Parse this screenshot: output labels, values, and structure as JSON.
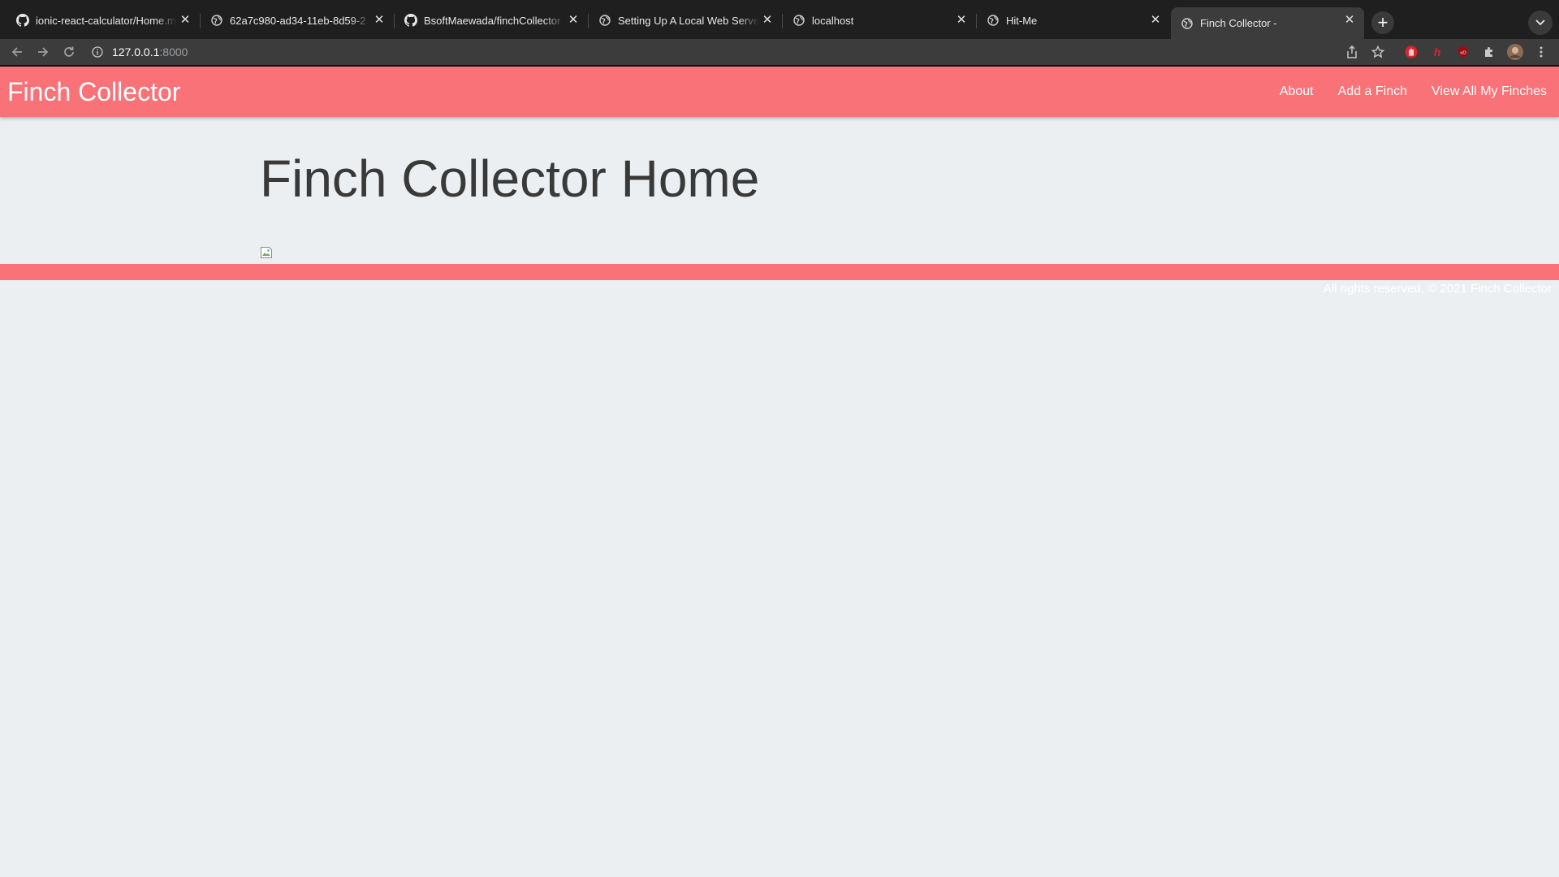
{
  "browser": {
    "tabs": [
      {
        "title": "ionic-react-calculator/Home.m",
        "icon": "github-icon",
        "active": false
      },
      {
        "title": "62a7c980-ad34-11eb-8d59-2",
        "icon": "globe-icon",
        "active": false
      },
      {
        "title": "BsoftMaewada/finchCollector",
        "icon": "github-icon",
        "active": false
      },
      {
        "title": "Setting Up A Local Web Server",
        "icon": "globe-icon",
        "active": false
      },
      {
        "title": "localhost",
        "icon": "globe-icon",
        "active": false
      },
      {
        "title": "Hit-Me",
        "icon": "globe-icon",
        "active": false
      },
      {
        "title": "Finch Collector -",
        "icon": "globe-icon",
        "active": true
      }
    ],
    "address": {
      "host": "127.0.0.1",
      "port": ":8000"
    }
  },
  "navbar": {
    "brand": "Finch Collector",
    "links": [
      {
        "label": "About"
      },
      {
        "label": "Add a Finch"
      },
      {
        "label": "View All My Finches"
      }
    ]
  },
  "main": {
    "title": "Finch Collector Home"
  },
  "footer": {
    "text": "All rights reserved, © 2021 Finch Collector"
  },
  "colors": {
    "accent": "#f87278",
    "page_background": "#eceff1",
    "heading_text": "#393939",
    "chrome_dark": "#1f1f1f",
    "chrome_toolbar": "#3c3c3c"
  }
}
